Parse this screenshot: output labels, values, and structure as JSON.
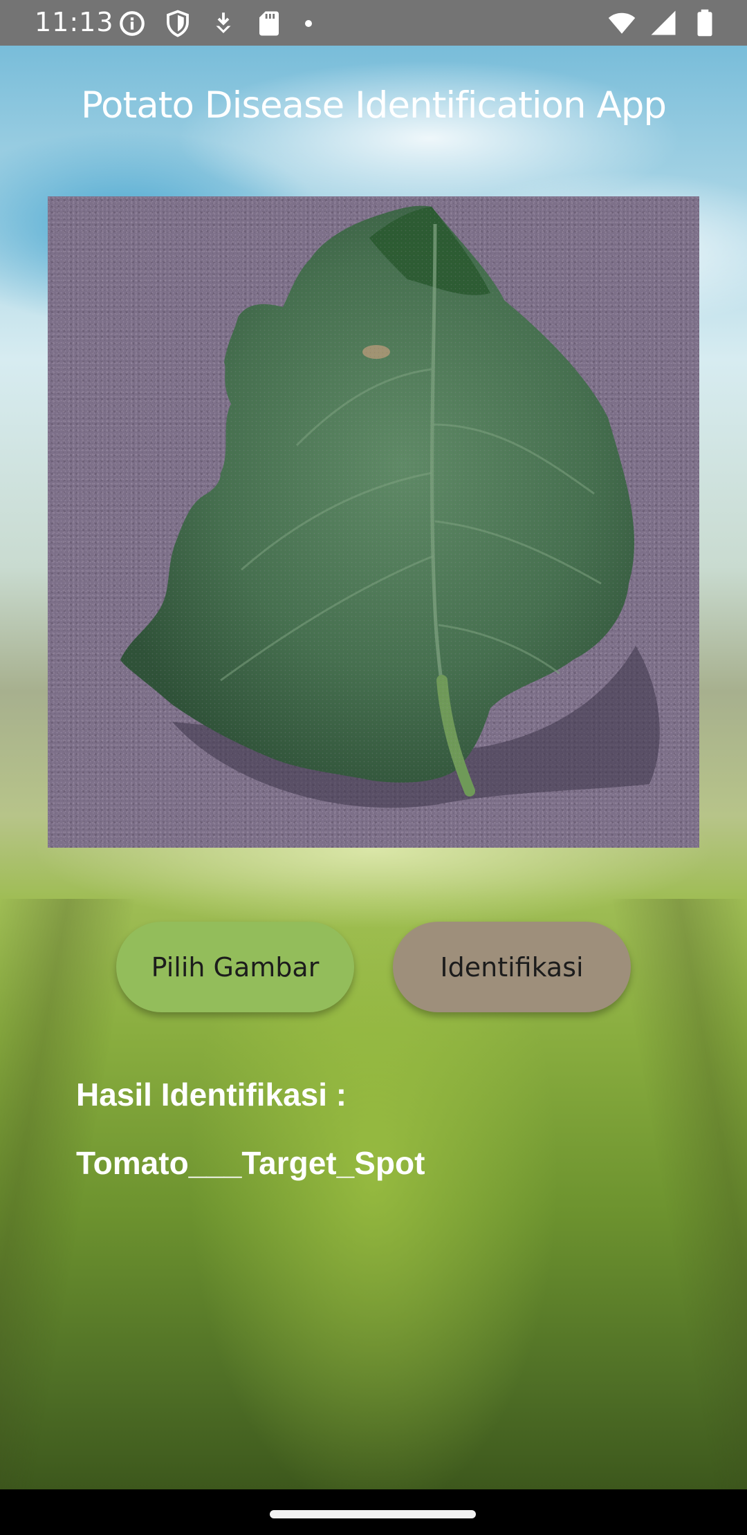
{
  "status_bar": {
    "time": "11:13",
    "left_icons": [
      "info-icon",
      "shield-icon",
      "download-icon",
      "sd-card-icon",
      "dot-icon"
    ],
    "right_icons": [
      "wifi-icon",
      "signal-icon",
      "battery-icon"
    ]
  },
  "app": {
    "title": "Potato Disease Identification App"
  },
  "image": {
    "subject": "leaf-image"
  },
  "buttons": {
    "pick_label": "Pilih Gambar",
    "identify_label": "Identifikasi"
  },
  "result": {
    "heading": "Hasil Identifikasi :",
    "value": "Tomato___Target_Spot"
  },
  "colors": {
    "pick_button": "#93bd5b",
    "identify_button": "#9e8f7b",
    "status_bar": "#747474"
  }
}
